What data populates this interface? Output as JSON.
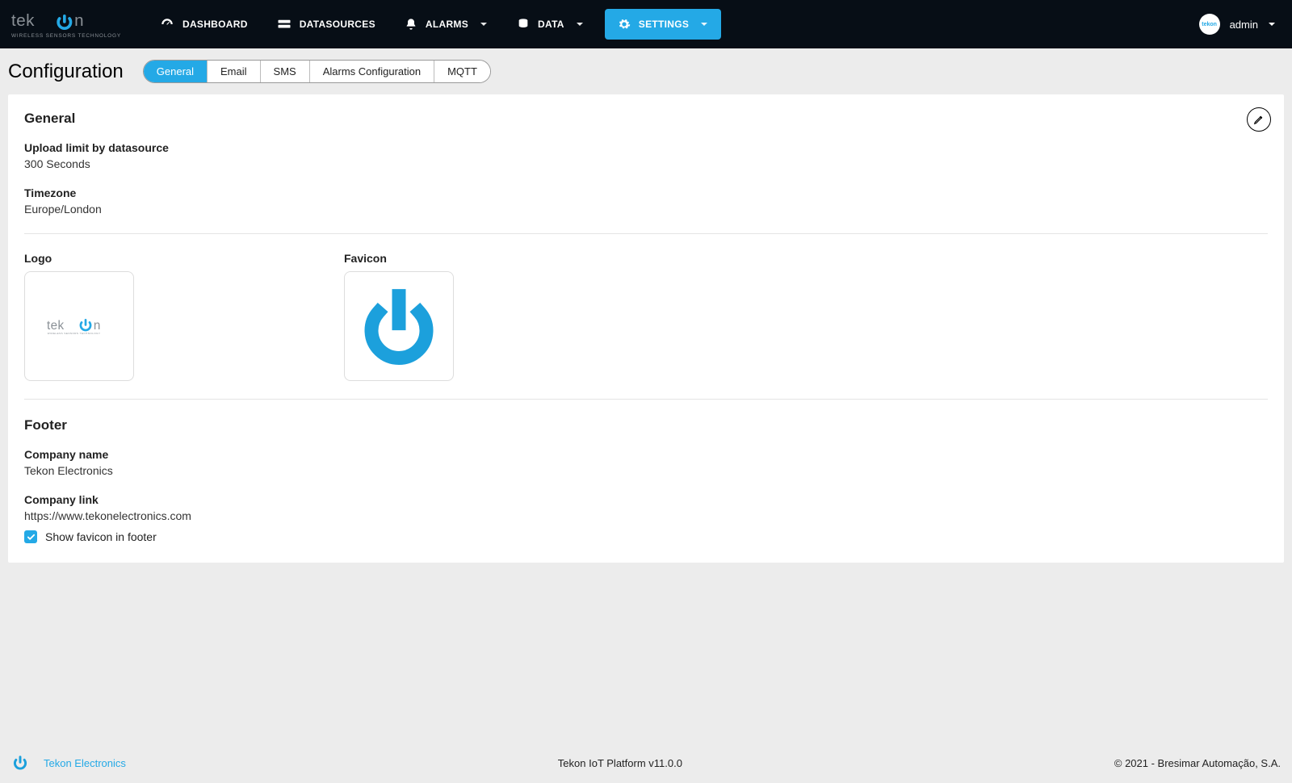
{
  "brand": {
    "sub": "WIRELESS SENSORS TECHNOLOGY"
  },
  "nav": {
    "dashboard": "DASHBOARD",
    "datasources": "DATASOURCES",
    "alarms": "ALARMS",
    "data": "DATA",
    "settings": "SETTINGS"
  },
  "user": {
    "name": "admin"
  },
  "page": {
    "title": "Configuration",
    "tabs": {
      "general": "General",
      "email": "Email",
      "sms": "SMS",
      "alarms_config": "Alarms Configuration",
      "mqtt": "MQTT"
    }
  },
  "general": {
    "heading": "General",
    "upload_limit_label": "Upload limit by datasource",
    "upload_limit_value": "300 Seconds",
    "timezone_label": "Timezone",
    "timezone_value": "Europe/London",
    "logo_label": "Logo",
    "favicon_label": "Favicon"
  },
  "footer_section": {
    "heading": "Footer",
    "company_name_label": "Company name",
    "company_name_value": "Tekon Electronics",
    "company_link_label": "Company link",
    "company_link_value": "https://www.tekonelectronics.com",
    "show_favicon_label": "Show favicon in footer"
  },
  "footer_bar": {
    "link": "Tekon Electronics",
    "center": "Tekon IoT Platform v11.0.0",
    "right": "© 2021 - Bresimar Automação, S.A."
  },
  "colors": {
    "accent": "#24A9E6"
  }
}
